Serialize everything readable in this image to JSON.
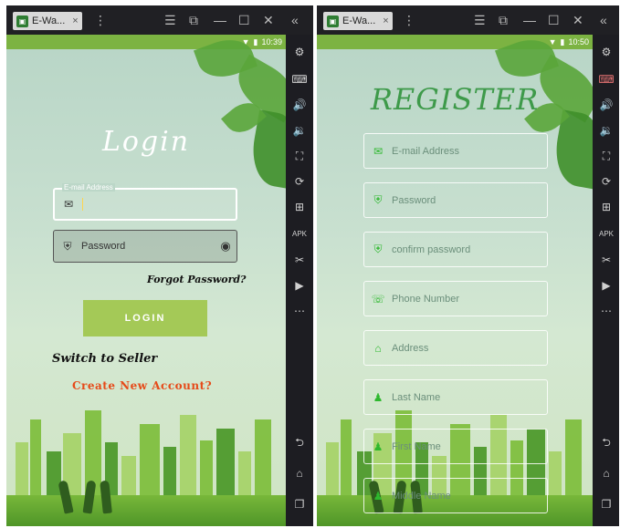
{
  "left": {
    "tab_label": "E-Wa...",
    "status_time": "10:39",
    "title": "Login",
    "email_label": "E-mail Address",
    "password_placeholder": "Password",
    "forgot_password": "Forgot Password?",
    "login_button": "LOGIN",
    "switch_seller": "Switch to Seller",
    "create_account": "Create New Account?"
  },
  "right": {
    "tab_label": "E-Wa...",
    "status_time": "10:50",
    "title": "REGISTER",
    "fields": [
      {
        "placeholder": "E-mail Address",
        "icon": "email-icon"
      },
      {
        "placeholder": "Password",
        "icon": "shield-icon"
      },
      {
        "placeholder": "confirm password",
        "icon": "shield-icon"
      },
      {
        "placeholder": "Phone Number",
        "icon": "phone-icon"
      },
      {
        "placeholder": "Address",
        "icon": "home-icon"
      },
      {
        "placeholder": "Last Name",
        "icon": "person-icon"
      },
      {
        "placeholder": "First Name",
        "icon": "person-icon"
      },
      {
        "placeholder": "Middle Name",
        "icon": "person-icon"
      }
    ]
  },
  "icons": {
    "tab_close": "×",
    "more": "⋮",
    "menu": "☰",
    "restore": "⧉",
    "minimize": "—",
    "maximize": "☐",
    "close": "✕",
    "collapse": "«",
    "mail": "✉",
    "shield": "⛨",
    "eye": "◉",
    "phone": "☏",
    "home": "⌂",
    "person": "♟",
    "apk": "APK",
    "back": "⮌",
    "android_home": "⌂",
    "recents": "❐"
  },
  "colors": {
    "status_green": "#7cb342",
    "button_green": "#a4c957",
    "create_account": "#e64a19",
    "register_title": "#3e9a4a",
    "field_icon": "#2eb82e"
  }
}
